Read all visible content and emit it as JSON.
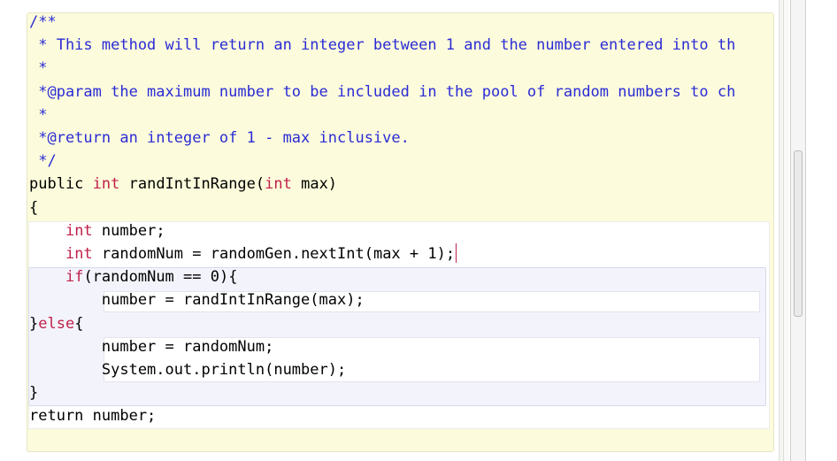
{
  "code_lines": [
    {
      "segments": [
        {
          "text": "/**",
          "style": "comment"
        }
      ]
    },
    {
      "segments": [
        {
          "text": " * This method will return an integer between 1 and the number entered into th",
          "style": "comment"
        }
      ]
    },
    {
      "segments": [
        {
          "text": " *",
          "style": "comment"
        }
      ]
    },
    {
      "segments": [
        {
          "text": " *@param the maximum number to be included in the pool of random numbers to ch",
          "style": "comment"
        }
      ]
    },
    {
      "segments": [
        {
          "text": " *",
          "style": "comment"
        }
      ]
    },
    {
      "segments": [
        {
          "text": " *@return an integer of 1 - max inclusive.",
          "style": "comment"
        }
      ]
    },
    {
      "segments": [
        {
          "text": " */",
          "style": "comment"
        }
      ]
    },
    {
      "segments": [
        {
          "text": "public ",
          "style": "plain"
        },
        {
          "text": "int",
          "style": "kw"
        },
        {
          "text": " randIntInRange(",
          "style": "plain"
        },
        {
          "text": "int",
          "style": "kw"
        },
        {
          "text": " max)",
          "style": "plain"
        }
      ]
    },
    {
      "segments": [
        {
          "text": "{",
          "style": "plain"
        }
      ]
    },
    {
      "segments": [
        {
          "text": "    ",
          "style": "plain"
        },
        {
          "text": "int",
          "style": "kw"
        },
        {
          "text": " number;",
          "style": "plain"
        }
      ]
    },
    {
      "segments": [
        {
          "text": "    ",
          "style": "plain"
        },
        {
          "text": "int",
          "style": "kw"
        },
        {
          "text": " randomNum = randomGen.nextInt(max + 1);",
          "style": "plain"
        }
      ],
      "cursor": true
    },
    {
      "segments": [
        {
          "text": "    ",
          "style": "plain"
        },
        {
          "text": "if",
          "style": "kw"
        },
        {
          "text": "(randomNum == 0){",
          "style": "plain"
        }
      ]
    },
    {
      "segments": [
        {
          "text": "        number = randIntInRange(max);",
          "style": "plain"
        }
      ]
    },
    {
      "segments": [
        {
          "text": "}",
          "style": "plain"
        },
        {
          "text": "else",
          "style": "kw"
        },
        {
          "text": "{",
          "style": "plain"
        }
      ]
    },
    {
      "segments": [
        {
          "text": "        number = randomNum;",
          "style": "plain"
        }
      ]
    },
    {
      "segments": [
        {
          "text": "        System.out.println(number);",
          "style": "plain"
        }
      ]
    },
    {
      "segments": [
        {
          "text": "}",
          "style": "plain"
        }
      ]
    },
    {
      "segments": [
        {
          "text": "return number;",
          "style": "plain"
        }
      ]
    }
  ],
  "colors": {
    "comment": "#2b2bd6",
    "keyword": "#c0214a",
    "class_block_bg": "#fcfcdc",
    "if_block_bg": "#f3f4fb"
  }
}
